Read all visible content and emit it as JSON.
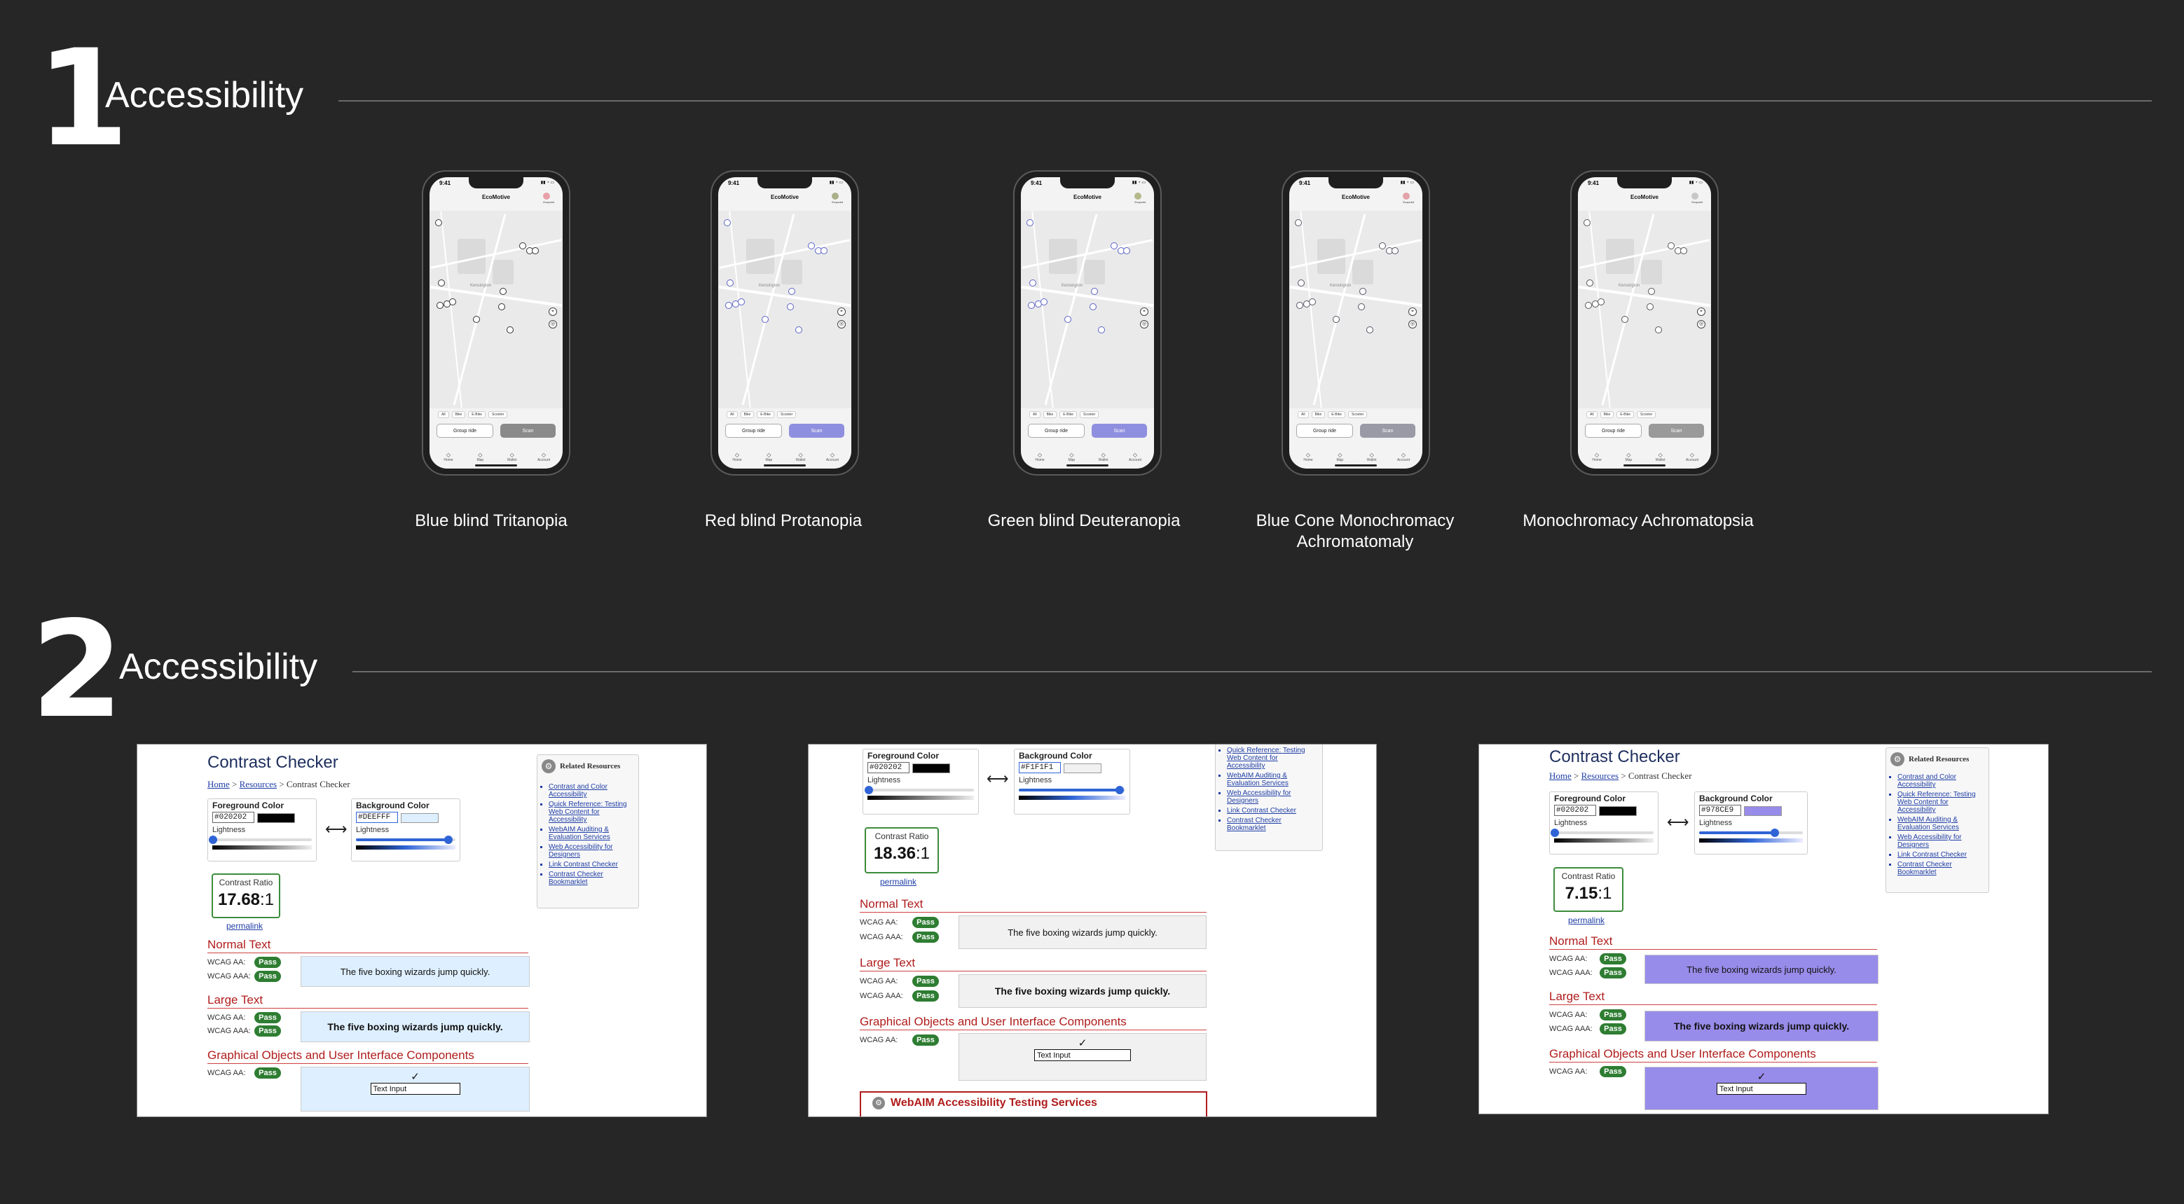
{
  "sections": [
    {
      "number": "1",
      "title": "Accessibility"
    },
    {
      "number": "2",
      "title": "Accessibility"
    }
  ],
  "phone": {
    "time": "9:41",
    "app_title": "EcoMotive",
    "ecopoint_label": "Ecopoint",
    "filters": [
      "All",
      "Bike",
      "E-Bike",
      "Scooter"
    ],
    "group_ride_label": "Group ride",
    "scan_label": "Scan",
    "place_label": "Kensington",
    "tabs": [
      {
        "icon": "home-icon",
        "label": "Home"
      },
      {
        "icon": "map-icon",
        "label": "Map"
      },
      {
        "icon": "wallet-icon",
        "label": "Wallet"
      },
      {
        "icon": "account-icon",
        "label": "Account"
      }
    ]
  },
  "simulations": [
    {
      "caption": "Blue blind Tritanopia",
      "accent": "#8a8a8a",
      "avatar": "#e8a0a8",
      "marker": "#333333"
    },
    {
      "caption": "Red blind Protanopia",
      "accent": "#8f8fdf",
      "avatar": "#a9b08a",
      "marker": "#5b63c9"
    },
    {
      "caption": "Green blind Deuteranopia",
      "accent": "#8f8fe0",
      "avatar": "#b5b88a",
      "marker": "#5b63c9"
    },
    {
      "caption": "Blue Cone Monochromacy Achromatomaly",
      "accent": "#9a9aa6",
      "avatar": "#e2a3a8",
      "marker": "#555566"
    },
    {
      "caption": "Monochromacy Achromatopsia",
      "accent": "#9a9a9a",
      "avatar": "#c7c7c7",
      "marker": "#555555"
    }
  ],
  "checkers": [
    {
      "title": "Contrast Checker",
      "crumb_home": "Home",
      "crumb_resources": "Resources",
      "crumb_current": "Contrast Checker",
      "foreground_label": "Foreground Color",
      "foreground_hex": "#020202",
      "foreground_color": "#020202",
      "background_label": "Background Color",
      "background_hex": "#DEEFFF",
      "background_color": "#DEEFFF",
      "lightness_label": "Lightness",
      "foreground_lightness": 0.01,
      "background_lightness": 0.93,
      "ratio_label": "Contrast Ratio",
      "ratio_value": "17.68",
      "ratio_suffix": ":1",
      "permalink": "permalink",
      "normal_text_heading": "Normal Text",
      "large_text_heading": "Large Text",
      "graphical_heading": "Graphical Objects and User Interface Components",
      "wcag_aa": "WCAG AA:",
      "wcag_aaa": "WCAG AAA:",
      "pass": "Pass",
      "sample_text": "The five boxing wizards jump quickly.",
      "text_input": "Text Input",
      "checkmark": "✓",
      "related_title": "Related Resources",
      "related_links": [
        "Contrast and Color Accessibility",
        "Quick Reference: Testing Web Content for Accessibility",
        "WebAIM Auditing & Evaluation Services",
        "Web Accessibility for Designers",
        "Link Contrast Checker",
        "Contrast Checker Bookmarklet"
      ]
    },
    {
      "foreground_label": "Foreground Color",
      "foreground_hex": "#020202",
      "foreground_color": "#020202",
      "background_label": "Background Color",
      "background_hex": "#F1F1F1",
      "background_color": "#F1F1F1",
      "lightness_label": "Lightness",
      "foreground_lightness": 0.01,
      "background_lightness": 0.95,
      "ratio_label": "Contrast Ratio",
      "ratio_value": "18.36",
      "ratio_suffix": ":1",
      "permalink": "permalink",
      "normal_text_heading": "Normal Text",
      "large_text_heading": "Large Text",
      "graphical_heading": "Graphical Objects and User Interface Components",
      "wcag_aa": "WCAG AA:",
      "wcag_aaa": "WCAG AAA:",
      "pass": "Pass",
      "sample_text": "The five boxing wizards jump quickly.",
      "text_input": "Text Input",
      "checkmark": "✓",
      "related_links": [
        "Quick Reference: Testing Web Content for Accessibility",
        "WebAIM Auditing & Evaluation Services",
        "Web Accessibility for Designers",
        "Link Contrast Checker",
        "Contrast Checker Bookmarklet"
      ],
      "webaim_services": "WebAIM Accessibility Testing Services"
    },
    {
      "title": "Contrast Checker",
      "crumb_home": "Home",
      "crumb_resources": "Resources",
      "crumb_current": "Contrast Checker",
      "foreground_label": "Foreground Color",
      "foreground_hex": "#020202",
      "foreground_color": "#020202",
      "background_label": "Background Color",
      "background_hex": "#978CE9",
      "background_color": "#978CE9",
      "lightness_label": "Lightness",
      "foreground_lightness": 0.01,
      "background_lightness": 0.73,
      "ratio_label": "Contrast Ratio",
      "ratio_value": "7.15",
      "ratio_suffix": ":1",
      "permalink": "permalink",
      "normal_text_heading": "Normal Text",
      "large_text_heading": "Large Text",
      "graphical_heading": "Graphical Objects and User Interface Components",
      "wcag_aa": "WCAG AA:",
      "wcag_aaa": "WCAG AAA:",
      "pass": "Pass",
      "sample_text": "The five boxing wizards jump quickly.",
      "text_input": "Text Input",
      "checkmark": "✓",
      "related_title": "Related Resources",
      "related_links": [
        "Contrast and Color Accessibility",
        "Quick Reference: Testing Web Content for Accessibility",
        "WebAIM Auditing & Evaluation Services",
        "Web Accessibility for Designers",
        "Link Contrast Checker",
        "Contrast Checker Bookmarklet"
      ]
    }
  ]
}
